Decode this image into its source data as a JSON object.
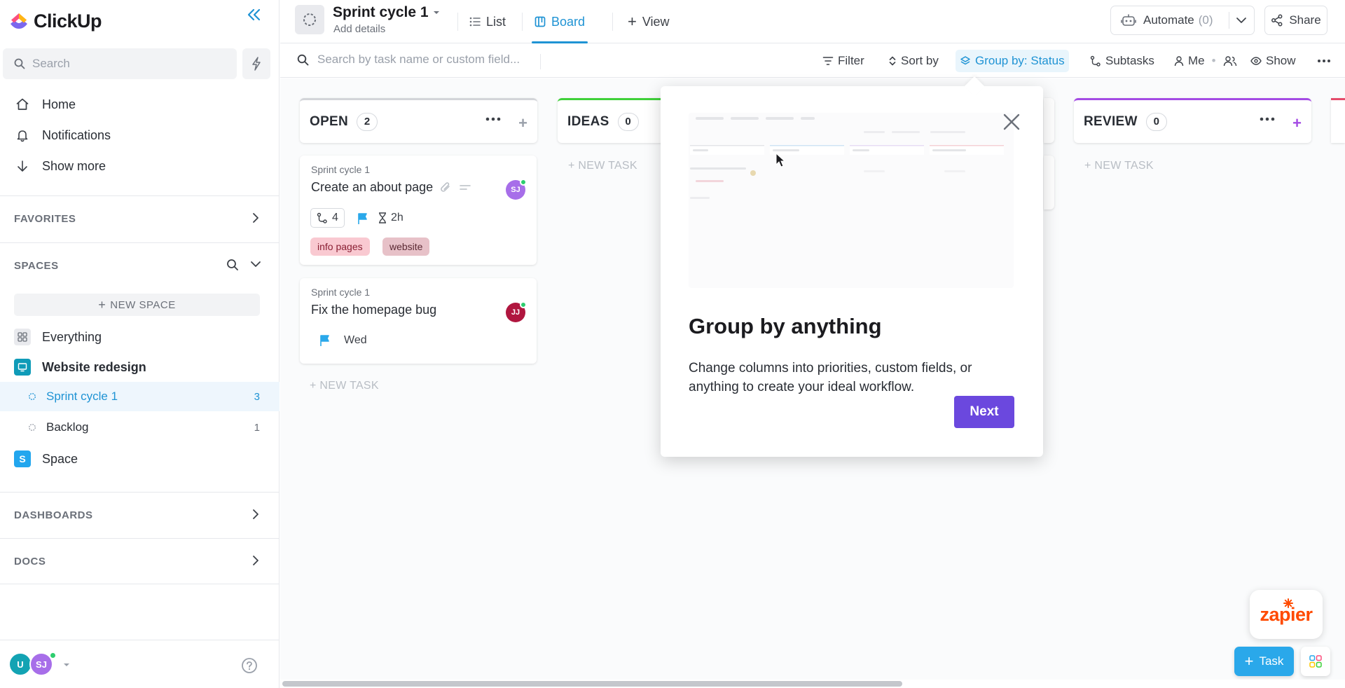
{
  "brand": {
    "name": "ClickUp"
  },
  "sidebar": {
    "search_placeholder": "Search",
    "nav": [
      {
        "label": "Home",
        "icon": "home-icon"
      },
      {
        "label": "Notifications",
        "icon": "bell-icon"
      },
      {
        "label": "Show more",
        "icon": "arrow-down-icon"
      }
    ],
    "favorites_label": "FAVORITES",
    "spaces_label": "SPACES",
    "new_space_label": "NEW SPACE",
    "spaces": [
      {
        "label": "Everything",
        "icon": "grid-icon"
      },
      {
        "label": "Website redesign",
        "icon": "monitor-icon",
        "color": "#0f9bb8"
      }
    ],
    "lists": [
      {
        "label": "Sprint cycle 1",
        "count": "3",
        "active": true
      },
      {
        "label": "Backlog",
        "count": "1",
        "active": false
      }
    ],
    "space_s": {
      "letter": "S",
      "label": "Space",
      "color": "#22a6ee"
    },
    "dashboards_label": "DASHBOARDS",
    "docs_label": "DOCS",
    "footer": {
      "avatar1": "U",
      "avatar2": "SJ"
    }
  },
  "header": {
    "title": "Sprint cycle 1",
    "subtitle": "Add details",
    "tabs": [
      {
        "label": "List",
        "active": false
      },
      {
        "label": "Board",
        "active": true
      }
    ],
    "add_view_label": "View",
    "automate_label": "Automate",
    "automate_count": "(0)",
    "share_label": "Share"
  },
  "toolbar": {
    "search_placeholder": "Search by task name or custom field...",
    "filter": "Filter",
    "sort": "Sort by",
    "group": "Group by: Status",
    "subtasks": "Subtasks",
    "me": "Me",
    "show": "Show"
  },
  "board": {
    "columns": [
      {
        "name": "OPEN",
        "count": "2",
        "color": "#d3d5d9"
      },
      {
        "name": "IDEAS",
        "count": "0",
        "color": "#3fd13a"
      },
      {
        "name": "REVIEW",
        "count": "0",
        "color": "#a44be4"
      }
    ],
    "new_task_label": "+ NEW TASK",
    "cards": [
      {
        "list": "Sprint cycle 1",
        "title": "Create an about page",
        "avatar": "SJ",
        "avatar_color": "#a76ee9",
        "subtasks": "4",
        "estimate": "2h",
        "tags": [
          {
            "label": "info pages",
            "bg": "#f9c9d1",
            "fg": "#8a1f33"
          },
          {
            "label": "website",
            "bg": "#e7c1c8",
            "fg": "#5b2933"
          }
        ]
      },
      {
        "list": "Sprint cycle 1",
        "title": "Fix the homepage bug",
        "avatar": "JJ",
        "avatar_color": "#b0163f",
        "due": "Wed"
      }
    ]
  },
  "popover": {
    "title": "Group by anything",
    "body": "Change columns into priorities, custom fields, or anything to create your ideal workflow.",
    "next_label": "Next"
  },
  "fab": {
    "zapier_label": "zapier",
    "task_label": "Task"
  }
}
